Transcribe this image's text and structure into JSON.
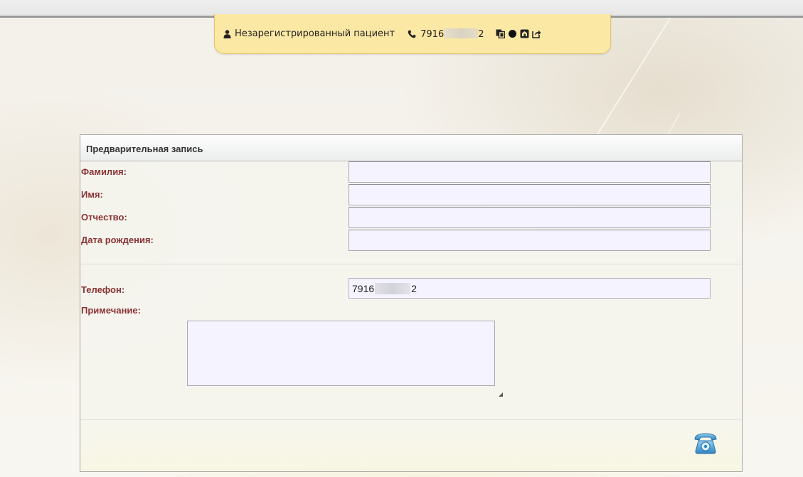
{
  "patient_bar": {
    "patient_name": "Незарегистрированный пациент",
    "phone_prefix": "7916",
    "phone_suffix": "2",
    "icons": [
      "user-icon",
      "phone-icon",
      "copy-icon",
      "record-icon",
      "card-icon",
      "forward-icon"
    ]
  },
  "form": {
    "title": "Предварительная запись",
    "last_name_label": "Фамилия:",
    "first_name_label": "Имя:",
    "middle_name_label": "Отчество:",
    "birth_date_label": "Дата рождения:",
    "phone_label": "Телефон:",
    "note_label": "Примечание:",
    "last_name_value": "",
    "first_name_value": "",
    "middle_name_value": "",
    "birth_date_value": "",
    "phone_prefix": "7916",
    "phone_suffix": "2",
    "note_value": ""
  },
  "colors": {
    "label": "#8a3232",
    "patient_bar_bg": "#fbe8a4",
    "input_bg": "#f4f3ff",
    "phone_icon_blue": "#4f9fd6"
  },
  "call_button_icon": "telephone-icon"
}
